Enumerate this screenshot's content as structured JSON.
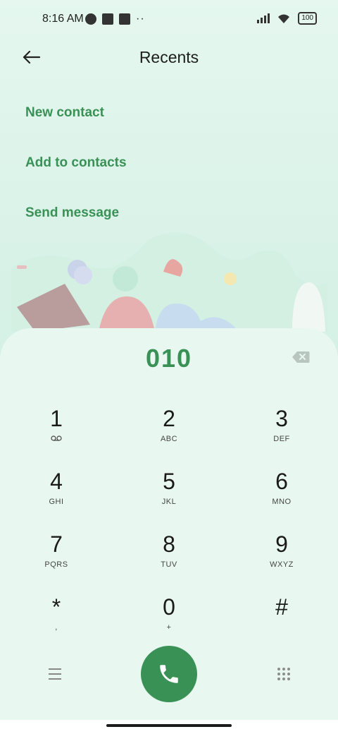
{
  "status_bar": {
    "time": "8:16 AM",
    "battery": "100"
  },
  "header": {
    "title": "Recents"
  },
  "menu": {
    "items": [
      {
        "label": "New contact"
      },
      {
        "label": "Add to contacts"
      },
      {
        "label": "Send message"
      }
    ]
  },
  "dialer": {
    "number": "010",
    "keys": [
      {
        "digit": "1",
        "letters": ""
      },
      {
        "digit": "2",
        "letters": "ABC"
      },
      {
        "digit": "3",
        "letters": "DEF"
      },
      {
        "digit": "4",
        "letters": "GHI"
      },
      {
        "digit": "5",
        "letters": "JKL"
      },
      {
        "digit": "6",
        "letters": "MNO"
      },
      {
        "digit": "7",
        "letters": "PQRS"
      },
      {
        "digit": "8",
        "letters": "TUV"
      },
      {
        "digit": "9",
        "letters": "WXYZ"
      },
      {
        "digit": "*",
        "letters": ","
      },
      {
        "digit": "0",
        "letters": "+"
      },
      {
        "digit": "#",
        "letters": ""
      }
    ]
  },
  "colors": {
    "accent": "#3a9156",
    "background": "#e3f5ee",
    "sheet": "#e8f8f1"
  },
  "icons": {
    "back": "arrow-left-icon",
    "delete": "backspace-icon",
    "voicemail": "voicemail-icon",
    "call": "phone-icon",
    "menu": "hamburger-icon",
    "keypad": "keypad-icon"
  }
}
